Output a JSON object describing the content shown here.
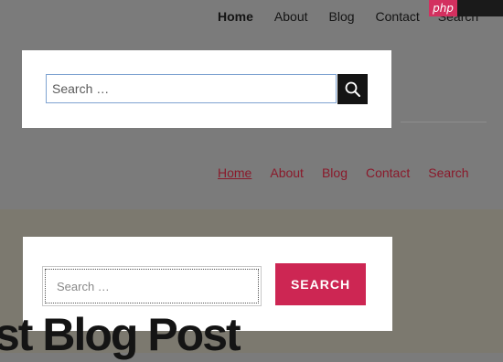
{
  "top_nav": {
    "items": [
      "Home",
      "About",
      "Blog",
      "Contact",
      "Search"
    ]
  },
  "badge": {
    "label": "php",
    "color": "#d3305f"
  },
  "search_card_1": {
    "placeholder": "Search …",
    "button_icon": "search-icon"
  },
  "mid_nav": {
    "items": [
      "Home",
      "About",
      "Blog",
      "Contact",
      "Search"
    ],
    "active": "Home",
    "link_color": "#8a1a2b"
  },
  "search_card_2": {
    "placeholder": "Search …",
    "button_label": "SEARCH",
    "button_color": "#cd2653"
  },
  "post": {
    "title": "st Blog Post"
  }
}
